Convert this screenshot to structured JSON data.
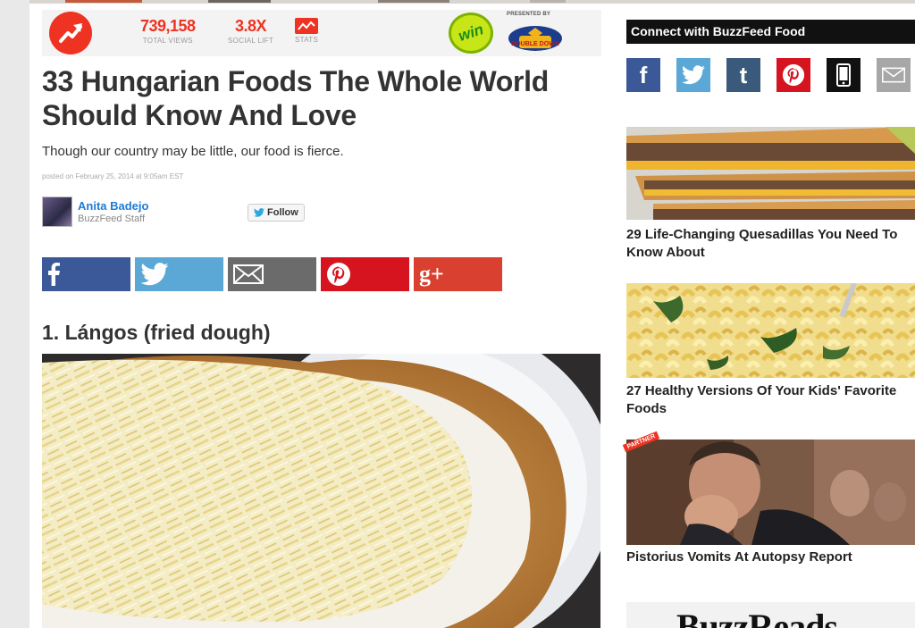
{
  "stats": {
    "total_views_value": "739,158",
    "total_views_label": "TOTAL VIEWS",
    "social_lift_value": "3.8X",
    "social_lift_label": "SOCIAL LIFT",
    "stats_label": "STATS",
    "win_badge": "win",
    "presented_by": "PRESENTED BY",
    "sponsor_logo_text": "DOUBLE DOWN"
  },
  "article": {
    "headline": "33 Hungarian Foods The Whole World Should Know And Love",
    "subheadline": "Though our country may be little, our food is fierce.",
    "posted": "posted on February 25, 2014 at 9:05am EST",
    "author_name": "Anita Badejo",
    "author_role": "BuzzFeed Staff",
    "follow_label": "Follow",
    "share_buttons": [
      "facebook",
      "twitter",
      "email",
      "pinterest",
      "google-plus"
    ],
    "google_plus_label": "g+",
    "item_title": "1. Lángos (fried dough)"
  },
  "sidebar": {
    "connect_title": "Connect with BuzzFeed Food",
    "social_icons": [
      "facebook",
      "twitter",
      "tumblr",
      "pinterest",
      "mobile",
      "email"
    ],
    "facebook_glyph": "f",
    "tumblr_glyph": "t",
    "stories": [
      {
        "title": "29 Life-Changing Quesadillas You Need To Know About"
      },
      {
        "title": "27 Healthy Versions Of Your Kids' Favorite Foods"
      },
      {
        "title": "Pistorius Vomits At Autopsy Report"
      }
    ],
    "partner_label": "PARTNER",
    "reads_logo": "BuzzReads"
  },
  "colors": {
    "accent": "#ee3322",
    "facebook": "#3b5998",
    "twitter": "#5ba8d6",
    "email": "#6b6b6b",
    "pinterest": "#d6141f",
    "google_plus": "#d9402f",
    "tumblr": "#3a5a7c",
    "link": "#1f7bd6"
  }
}
